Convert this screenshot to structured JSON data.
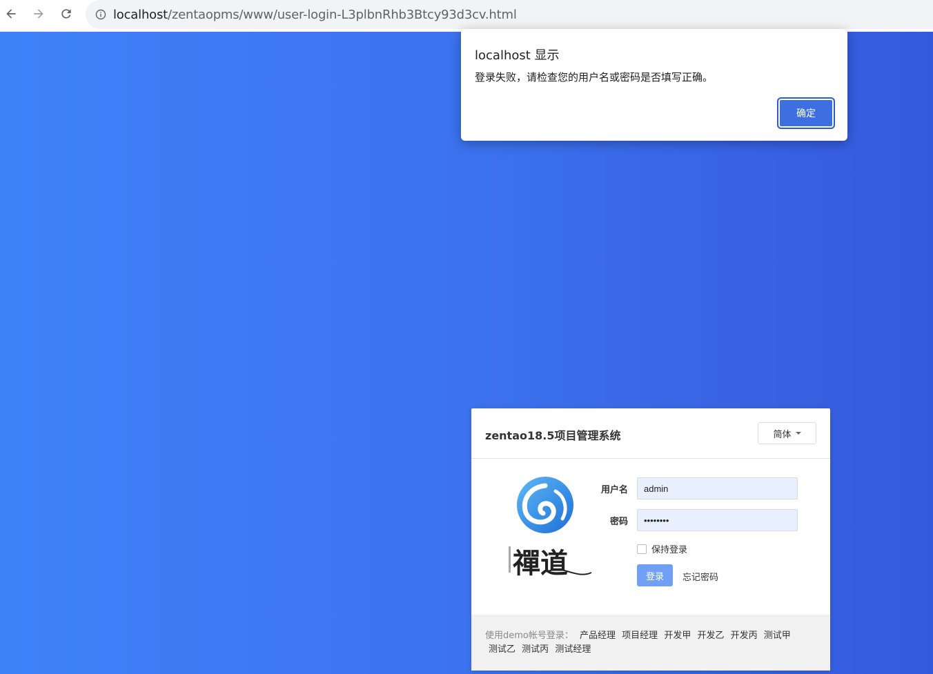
{
  "browser": {
    "url_host": "localhost",
    "url_path": "/zentaopms/www/user-login-L3plbnRhb3Btcy93d3cv.html"
  },
  "alert": {
    "title": "localhost 显示",
    "message": "登录失败，请检查您的用户名或密码是否填写正确。",
    "ok_label": "确定"
  },
  "login": {
    "title": "zentao18.5项目管理系统",
    "language": "简体",
    "username_label": "用户名",
    "username_value": "admin",
    "password_label": "密码",
    "password_value": "••••••••",
    "remember_label": "保持登录",
    "submit_label": "登录",
    "forgot_label": "忘记密码",
    "logo_text": "禪道",
    "demo_label": "使用demo帐号登录：",
    "demo_accounts": [
      "产品经理",
      "项目经理",
      "开发甲",
      "开发乙",
      "开发丙",
      "测试甲",
      "测试乙",
      "测试丙",
      "测试经理"
    ]
  },
  "colors": {
    "page_gradient_start": "#3f82f8",
    "page_gradient_end": "#3559dc",
    "login_button": "#6fa0f5",
    "alert_button": "#3d6fe0"
  }
}
